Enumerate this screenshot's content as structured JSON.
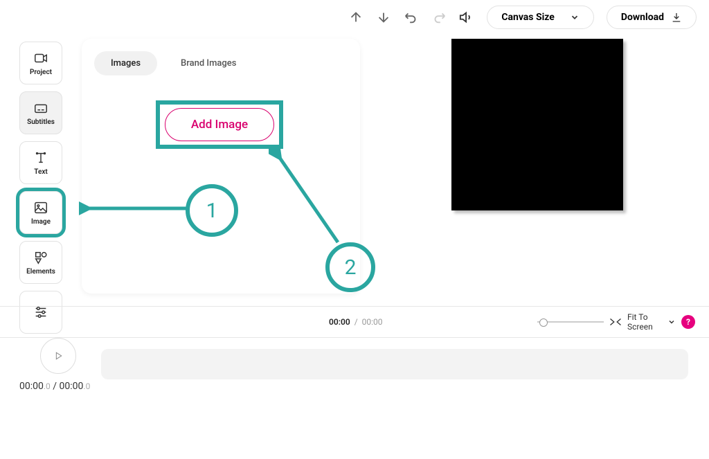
{
  "toolbar": {
    "canvas_size_label": "Canvas Size",
    "download_label": "Download"
  },
  "sidebar": {
    "project": "Project",
    "subtitles": "Subtitles",
    "text": "Text",
    "image": "Image",
    "elements": "Elements"
  },
  "panel": {
    "tab_images": "Images",
    "tab_brand_images": "Brand Images",
    "add_image_label": "Add Image"
  },
  "annotations": {
    "step1": "1",
    "step2": "2"
  },
  "timestrip": {
    "current": "00:00",
    "separator": "/",
    "duration": "00:00",
    "fit_label": "Fit To Screen",
    "help": "?"
  },
  "timeline": {
    "current": "00:00",
    "current_frac": ".0",
    "sep": " / ",
    "duration": "00:00",
    "duration_frac": ".0"
  }
}
